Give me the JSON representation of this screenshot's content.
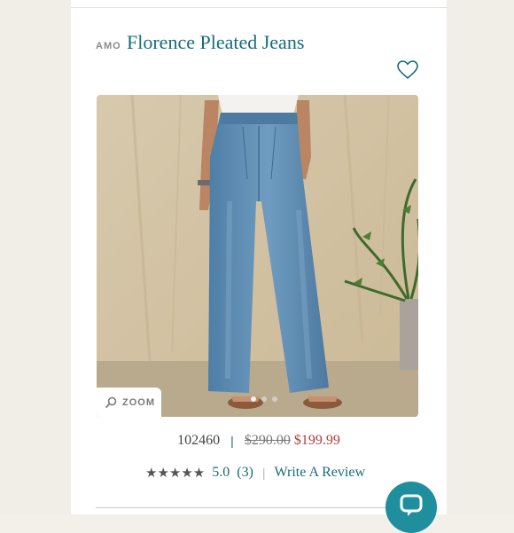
{
  "product": {
    "brand": "AMO",
    "title": "Florence Pleated Jeans",
    "sku": "102460",
    "separator": "|",
    "original_price": "$290.00",
    "sale_price": "$199.99"
  },
  "gallery": {
    "zoom_label": "ZOOM",
    "slide_count": 3,
    "active_slide": 1
  },
  "reviews": {
    "stars": "★★★★★",
    "score": "5.0",
    "count": "(3)",
    "separator": "|",
    "write_review": "Write A Review"
  },
  "icons": {
    "wishlist": "heart-outline-icon",
    "zoom": "magnifier-icon",
    "chat": "chat-bubble-icon"
  },
  "colors": {
    "brand_teal": "#166c79",
    "sale_red": "#b23b3b",
    "chat_button": "#1f8e9d"
  }
}
